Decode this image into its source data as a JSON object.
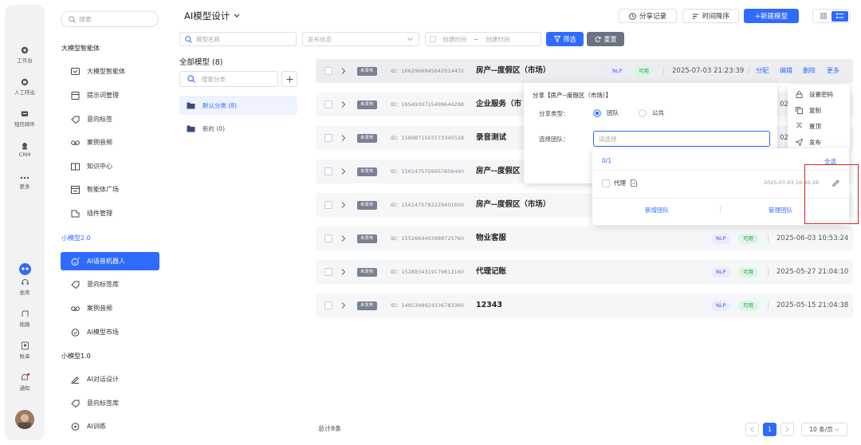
{
  "rail": {
    "items": [
      {
        "label": "工作台",
        "icon": "workbench-icon"
      },
      {
        "label": "人工呼出",
        "icon": "manual-call-icon"
      },
      {
        "label": "短信邮件",
        "icon": "sms-mail-icon"
      },
      {
        "label": "CRM",
        "icon": "crm-icon"
      },
      {
        "label": "更多",
        "icon": "more-icon"
      }
    ],
    "bottom_items": [
      {
        "label": "坐席",
        "icon": "seat-icon"
      },
      {
        "label": "拖路",
        "icon": "route-icon"
      },
      {
        "label": "账单",
        "icon": "bill-icon"
      },
      {
        "label": "通知",
        "icon": "bell-icon"
      }
    ]
  },
  "nav": {
    "search_placeholder": "搜索",
    "sections": [
      {
        "title": "大模型智能体",
        "items": [
          {
            "label": "大模型智能体",
            "icon": "agent-icon"
          },
          {
            "label": "提示词管理",
            "icon": "prompt-icon"
          },
          {
            "label": "意向标签",
            "icon": "tag-icon"
          },
          {
            "label": "案例音频",
            "icon": "audio-icon"
          },
          {
            "label": "知识中心",
            "icon": "book-icon"
          },
          {
            "label": "智能体广场",
            "icon": "square-icon"
          },
          {
            "label": "插件管理",
            "icon": "plugin-icon"
          }
        ]
      },
      {
        "title": "小模型2.0",
        "items": [
          {
            "label": "AI语音机器人",
            "icon": "robot-icon",
            "active": true
          },
          {
            "label": "意向标签库",
            "icon": "tag-icon"
          },
          {
            "label": "案例音频",
            "icon": "audio-icon"
          },
          {
            "label": "AI模型市场",
            "icon": "market-icon"
          }
        ]
      },
      {
        "title": "小模型1.0",
        "items": [
          {
            "label": "AI对话设计",
            "icon": "pen-icon"
          },
          {
            "label": "意向标签库",
            "icon": "tag-icon"
          },
          {
            "label": "AI训练",
            "icon": "train-icon"
          }
        ]
      }
    ]
  },
  "header": {
    "title": "AI模型设计",
    "share_record": "分享记录",
    "time_sort": "时间降序",
    "new_model": "+新建模型"
  },
  "filters": {
    "model_name_placeholder": "模型名称",
    "status_placeholder": "发布状态",
    "start_placeholder": "创建时间",
    "range_sep": "~",
    "end_placeholder": "创建时间",
    "filter_btn": "筛选",
    "reset_btn": "重置"
  },
  "categories": {
    "title": "全部模型 (8)",
    "search_placeholder": "搜索分类",
    "items": [
      {
        "label": "默认分类 (8)",
        "active": true
      },
      {
        "label": "新的 (0)",
        "active": false
      }
    ]
  },
  "rows": [
    {
      "status": "未发布",
      "id": "ID：1662966845642014472",
      "name": "房产--度假区（市场）",
      "nlp": "NLP",
      "avail": "可用",
      "time": "2025-07-03 21:23:39",
      "actions": [
        "分配",
        "编辑",
        "删除",
        "更多"
      ]
    },
    {
      "status": "未发布",
      "id": "ID：1654930715499644288",
      "name": "企业服务（市",
      "time_partial": "02"
    },
    {
      "status": "未发布",
      "id": "ID：1589871503173345528",
      "name": "录音测试",
      "time_partial": "02"
    },
    {
      "status": "未发布",
      "id": "ID：1561475759957606440",
      "name": "房产--度假区"
    },
    {
      "status": "未发布",
      "id": "ID：1561475782229401600",
      "name": "房产--度假区（市场）"
    },
    {
      "status": "未发布",
      "id": "ID：1552664403988725760",
      "name": "物业客服",
      "nlp": "NLP",
      "avail": "可用",
      "time": "2025-06-03 10:53:24"
    },
    {
      "status": "未发布",
      "id": "ID：1528834319179612160",
      "name": "代理记账",
      "nlp": "NLP",
      "avail": "可用",
      "time": "2025-05-27 21:04:10"
    },
    {
      "status": "未发布",
      "id": "ID：1485348924336783360",
      "name": "12343",
      "nlp": "NLP",
      "avail": "可用",
      "time": "2025-05-15 21:04:38"
    }
  ],
  "share_popup": {
    "title": "分享【房产--度假区（市场）】",
    "type_label": "分享类型：",
    "type_team": "团队",
    "type_public": "公共",
    "team_label": "选择团队：",
    "team_placeholder": "请选择"
  },
  "more_menu": {
    "items": [
      "设置密码",
      "复制",
      "置顶",
      "发布"
    ]
  },
  "team_dropdown": {
    "count": "0/1",
    "select_all": "全选",
    "team_name": "代理",
    "team_time": "2025-07-03 16:40:28",
    "add_team": "新增团队",
    "manage_team": "管理团队"
  },
  "footer": {
    "total": "总计8条",
    "page": "1",
    "page_size": "10 条/页"
  },
  "colors": {
    "accent": "#2f6bff",
    "highlight_box": "#e02020"
  }
}
